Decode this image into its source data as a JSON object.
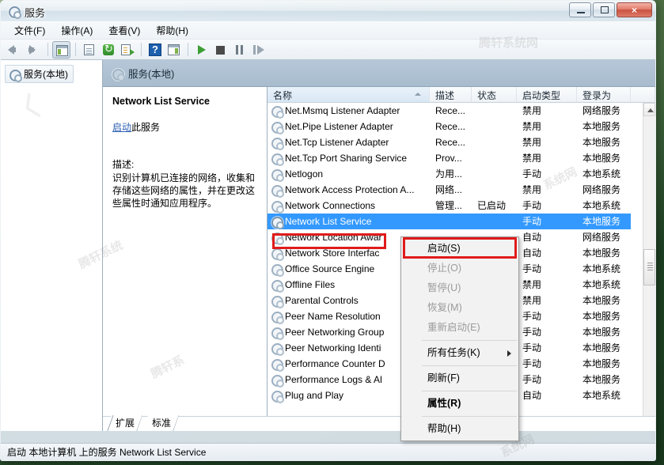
{
  "window": {
    "title": "服务",
    "title_icon": "services-gear-icon",
    "buttons": {
      "minimize": "minimize-button",
      "maximize": "maximize-button",
      "close": "×"
    }
  },
  "menubar": [
    {
      "label": "文件(F)",
      "name": "menu-file"
    },
    {
      "label": "操作(A)",
      "name": "menu-action"
    },
    {
      "label": "查看(V)",
      "name": "menu-view"
    },
    {
      "label": "帮助(H)",
      "name": "menu-help"
    }
  ],
  "toolbar": [
    {
      "name": "back-button",
      "icon": "arrow-left-icon"
    },
    {
      "name": "forward-button",
      "icon": "arrow-right-icon"
    },
    {
      "name": "show-hide-tree-button",
      "icon": "tree-panel-icon"
    },
    {
      "name": "properties-button",
      "icon": "document-icon"
    },
    {
      "name": "refresh-button",
      "icon": "refresh-icon"
    },
    {
      "name": "export-list-button",
      "icon": "export-icon"
    },
    {
      "name": "help-button",
      "icon": "help-icon"
    },
    {
      "name": "show-action-pane-button",
      "icon": "action-pane-icon"
    },
    {
      "name": "start-service-button",
      "icon": "play-icon"
    },
    {
      "name": "stop-service-button",
      "icon": "stop-icon"
    },
    {
      "name": "pause-service-button",
      "icon": "pause-icon"
    },
    {
      "name": "restart-service-button",
      "icon": "restart-icon"
    }
  ],
  "tree": {
    "root_label": "服务(本地)",
    "icon": "services-gear-icon"
  },
  "pane_header": {
    "label": "服务(本地)",
    "icon": "services-gear-icon"
  },
  "detail": {
    "service_title": "Network List Service",
    "action_link": "启动",
    "action_suffix": "此服务",
    "desc_label": "描述:",
    "desc_text": "识别计算机已连接的网络，收集和存储这些网络的属性，并在更改这些属性时通知应用程序。"
  },
  "list": {
    "columns": [
      {
        "label": "名称",
        "name": "column-name",
        "sorted": true
      },
      {
        "label": "描述",
        "name": "column-description",
        "sorted": false
      },
      {
        "label": "状态",
        "name": "column-status",
        "sorted": false
      },
      {
        "label": "启动类型",
        "name": "column-startup-type",
        "sorted": false
      },
      {
        "label": "登录为",
        "name": "column-logon-as",
        "sorted": false
      }
    ],
    "rows": [
      {
        "name": "Net.Msmq Listener Adapter",
        "desc": "Rece...",
        "status": "",
        "startup": "禁用",
        "logon": "网络服务",
        "selected": false
      },
      {
        "name": "Net.Pipe Listener Adapter",
        "desc": "Rece...",
        "status": "",
        "startup": "禁用",
        "logon": "本地服务",
        "selected": false
      },
      {
        "name": "Net.Tcp Listener Adapter",
        "desc": "Rece...",
        "status": "",
        "startup": "禁用",
        "logon": "本地服务",
        "selected": false
      },
      {
        "name": "Net.Tcp Port Sharing Service",
        "desc": "Prov...",
        "status": "",
        "startup": "禁用",
        "logon": "本地服务",
        "selected": false
      },
      {
        "name": "Netlogon",
        "desc": "为用...",
        "status": "",
        "startup": "手动",
        "logon": "本地系统",
        "selected": false
      },
      {
        "name": "Network Access Protection A...",
        "desc": "网络...",
        "status": "",
        "startup": "禁用",
        "logon": "网络服务",
        "selected": false
      },
      {
        "name": "Network Connections",
        "desc": "管理...",
        "status": "已启动",
        "startup": "手动",
        "logon": "本地系统",
        "selected": false
      },
      {
        "name": "Network List Service",
        "desc": "",
        "status": "",
        "startup": "手动",
        "logon": "本地服务",
        "selected": true
      },
      {
        "name": "Network Location Awar",
        "desc": "",
        "status": "",
        "startup": "自动",
        "logon": "网络服务",
        "selected": false
      },
      {
        "name": "Network Store Interfac",
        "desc": "",
        "status": "",
        "startup": "自动",
        "logon": "本地服务",
        "selected": false
      },
      {
        "name": "Office Source Engine",
        "desc": "",
        "status": "",
        "startup": "手动",
        "logon": "本地系统",
        "selected": false
      },
      {
        "name": "Offline Files",
        "desc": "",
        "status": "",
        "startup": "禁用",
        "logon": "本地系统",
        "selected": false
      },
      {
        "name": "Parental Controls",
        "desc": "",
        "status": "",
        "startup": "禁用",
        "logon": "本地服务",
        "selected": false
      },
      {
        "name": "Peer Name Resolution",
        "desc": "",
        "status": "",
        "startup": "手动",
        "logon": "本地服务",
        "selected": false
      },
      {
        "name": "Peer Networking Group",
        "desc": "",
        "status": "",
        "startup": "手动",
        "logon": "本地服务",
        "selected": false
      },
      {
        "name": "Peer Networking Identi",
        "desc": "",
        "status": "",
        "startup": "手动",
        "logon": "本地服务",
        "selected": false
      },
      {
        "name": "Performance Counter D",
        "desc": "",
        "status": "",
        "startup": "手动",
        "logon": "本地服务",
        "selected": false
      },
      {
        "name": "Performance Logs & Al",
        "desc": "",
        "status": "",
        "startup": "手动",
        "logon": "本地服务",
        "selected": false
      },
      {
        "name": "Plug and Play",
        "desc": "",
        "status": "",
        "startup": "自动",
        "logon": "本地系统",
        "selected": false
      }
    ]
  },
  "context_menu": {
    "items": [
      {
        "label": "启动(S)",
        "name": "ctx-start",
        "disabled": false,
        "bold": false,
        "highlighted": true,
        "submenu": false
      },
      {
        "label": "停止(O)",
        "name": "ctx-stop",
        "disabled": true,
        "bold": false,
        "highlighted": false,
        "submenu": false
      },
      {
        "label": "暂停(U)",
        "name": "ctx-pause",
        "disabled": true,
        "bold": false,
        "highlighted": false,
        "submenu": false
      },
      {
        "label": "恢复(M)",
        "name": "ctx-resume",
        "disabled": true,
        "bold": false,
        "highlighted": false,
        "submenu": false
      },
      {
        "label": "重新启动(E)",
        "name": "ctx-restart",
        "disabled": true,
        "bold": false,
        "highlighted": false,
        "submenu": false
      },
      {
        "separator": true
      },
      {
        "label": "所有任务(K)",
        "name": "ctx-all-tasks",
        "disabled": false,
        "bold": false,
        "highlighted": false,
        "submenu": true
      },
      {
        "separator": true
      },
      {
        "label": "刷新(F)",
        "name": "ctx-refresh",
        "disabled": false,
        "bold": false,
        "highlighted": false,
        "submenu": false
      },
      {
        "separator": true
      },
      {
        "label": "属性(R)",
        "name": "ctx-properties",
        "disabled": false,
        "bold": true,
        "highlighted": false,
        "submenu": false
      },
      {
        "separator": true
      },
      {
        "label": "帮助(H)",
        "name": "ctx-help",
        "disabled": false,
        "bold": false,
        "highlighted": false,
        "submenu": false
      }
    ]
  },
  "tabs": [
    {
      "label": "扩展",
      "name": "tab-extended",
      "active": false
    },
    {
      "label": "标准",
      "name": "tab-standard",
      "active": true
    }
  ],
  "statusbar": {
    "text": "启动 本地计算机 上的服务 Network List Service"
  },
  "colors": {
    "selection": "#3399ff",
    "annotation": "#e01b1b",
    "link": "#2a5db0",
    "pane_header": "#a8bccd"
  }
}
